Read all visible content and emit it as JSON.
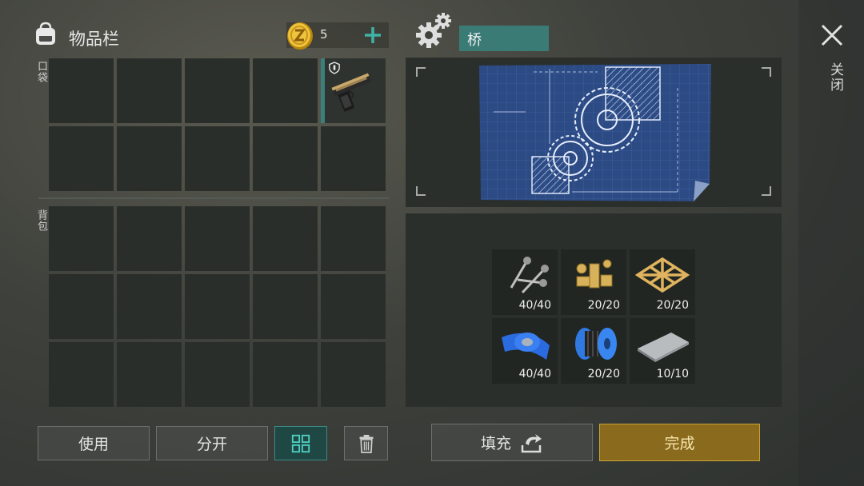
{
  "inventory": {
    "title": "物品栏",
    "coins": "5",
    "pocket_label": "口袋",
    "backpack_label": "背包",
    "pocket_item": "pistol-icon"
  },
  "actions": {
    "use_label": "使用",
    "split_label": "分开",
    "sort_icon": "grid-sort-icon",
    "trash_icon": "trash-icon"
  },
  "craft": {
    "name": "桥",
    "fill_label": "填充",
    "complete_label": "完成",
    "ingredients": [
      {
        "icon": "screws-icon",
        "count": "40/40"
      },
      {
        "icon": "nuts-bolts-icon",
        "count": "20/20"
      },
      {
        "icon": "wood-frame-icon",
        "count": "20/20"
      },
      {
        "icon": "blue-tape-icon",
        "count": "40/40"
      },
      {
        "icon": "wire-spool-icon",
        "count": "20/20"
      },
      {
        "icon": "metal-plate-icon",
        "count": "10/10"
      }
    ]
  },
  "close_label": "关闭",
  "colors": {
    "accent_teal": "#3b7b76",
    "gold": "#8a6a1c",
    "blueprint": "#2c4a84"
  }
}
